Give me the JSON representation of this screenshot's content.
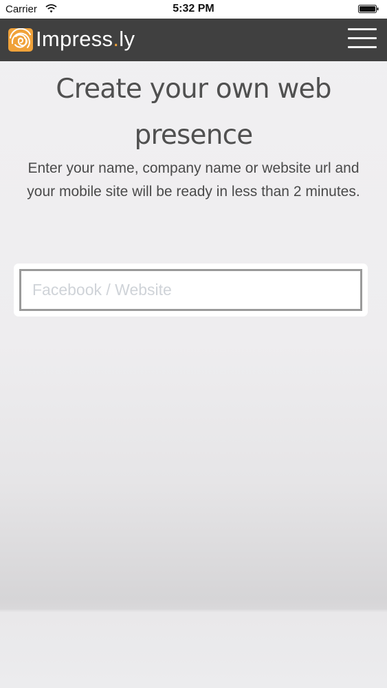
{
  "status_bar": {
    "carrier": "Carrier",
    "time": "5:32 PM"
  },
  "navbar": {
    "brand_prefix": "Impress",
    "brand_dot": ".",
    "brand_suffix": "ly",
    "logo_icon": "fingerprint-spiral-logo",
    "menu_icon": "hamburger-menu-icon",
    "accent_color": "#f0a23a",
    "background_color": "#404040"
  },
  "main": {
    "headline": "Create your own web presence",
    "subtext": "Enter your name, company name or website url and your mobile site will be ready in less than 2 minutes.",
    "search": {
      "value": "",
      "placeholder": "Facebook / Website"
    }
  }
}
